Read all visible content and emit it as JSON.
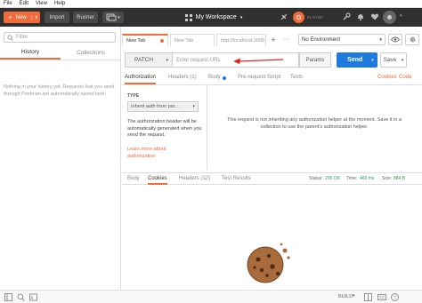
{
  "menubar": {
    "items": [
      "File",
      "Edit",
      "View",
      "Help"
    ]
  },
  "topbar": {
    "new_label": "New",
    "import_label": "Import",
    "runner_label": "Runner",
    "workspace_label": "My Workspace",
    "sync_label": "IN SYNC",
    "bg": "#303030",
    "accent": "#f26b3a"
  },
  "sidebar": {
    "filter_placeholder": "Filter",
    "tabs": [
      "History",
      "Collections"
    ],
    "empty_text": "Nothing in your history yet. Requests that you send through Postman are automatically saved here."
  },
  "request_tabs": [
    {
      "label": "New Tab"
    },
    {
      "label": "New Tab"
    },
    {
      "label": "http://localhost:3000"
    }
  ],
  "environment": {
    "selected": "No Environment"
  },
  "request": {
    "method": "PATCH",
    "url_placeholder": "Enter request URL",
    "params_label": "Params",
    "send_label": "Send",
    "save_label": "Save"
  },
  "subtabs": {
    "items": [
      "Authorization",
      "Headers (1)",
      "Body",
      "Pre-request Script",
      "Tests"
    ],
    "cookies": "Cookies",
    "code": "Code"
  },
  "auth": {
    "type_label": "TYPE",
    "type_value": "Inherit auth from par...",
    "desc": "The authorization header will be automatically generated when you send the request.",
    "learn_more": "Learn more about authorization",
    "right_text": "This request is not inheriting any authorization helper at the moment. Save it in a collection to use the parent's authorization helper."
  },
  "response": {
    "tabs": [
      "Body",
      "Cookies",
      "Headers (12)",
      "Test Results"
    ],
    "status_label": "Status:",
    "status_value": "200 OK",
    "time_label": "Time:",
    "time_value": "460 ms",
    "size_label": "Size:",
    "size_value": "884 B",
    "status_color": "#2a9d4a"
  },
  "statusbar": {
    "build_label": "BUILD"
  }
}
